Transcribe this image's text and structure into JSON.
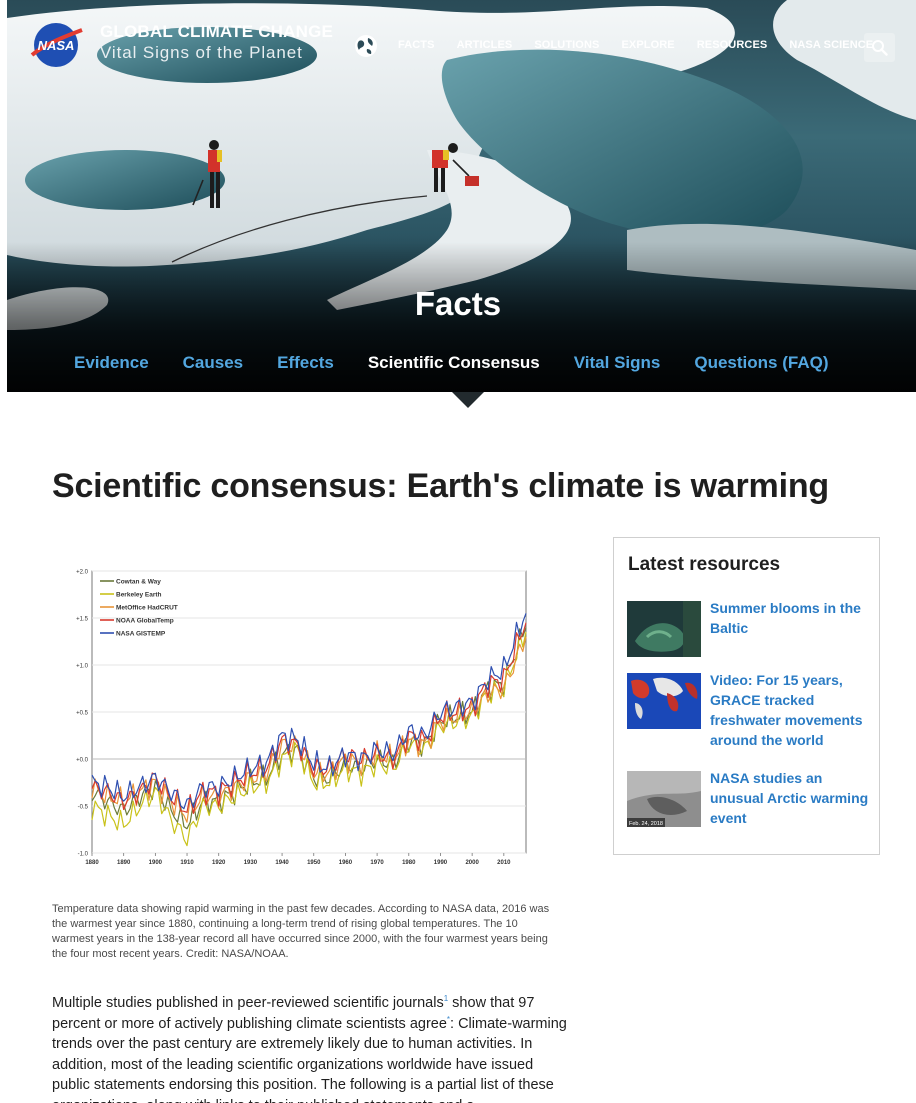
{
  "header": {
    "brand_title": "GLOBAL CLIMATE CHANGE",
    "brand_subtitle": "Vital Signs of the Planet",
    "logo_text": "NASA",
    "nav": [
      "FACTS",
      "ARTICLES",
      "SOLUTIONS",
      "EXPLORE",
      "RESOURCES",
      "NASA SCIENCE"
    ]
  },
  "hero": {
    "title": "Facts",
    "tabs": [
      {
        "label": "Evidence",
        "active": false
      },
      {
        "label": "Causes",
        "active": false
      },
      {
        "label": "Effects",
        "active": false
      },
      {
        "label": "Scientific Consensus",
        "active": true
      },
      {
        "label": "Vital Signs",
        "active": false
      },
      {
        "label": "Questions (FAQ)",
        "active": false
      }
    ]
  },
  "main": {
    "heading": "Scientific consensus: Earth's climate is warming",
    "caption": "Temperature data showing rapid warming in the past few decades. According to NASA data, 2016 was the warmest year since 1880, continuing a long-term trend of rising global temperatures. The 10 warmest years in the 138-year record all have occurred since 2000, with the four warmest years being the four most recent years. Credit: NASA/NOAA.",
    "body_part1": "Multiple studies published in peer-reviewed scientific journals",
    "body_ref": "1",
    "body_part2": " show that 97 percent or more of actively publishing climate scientists agree",
    "body_star": "*",
    "body_part3": ": Climate-warming trends over the past century are extremely likely due to human activities. In addition, most of the leading scientific organizations worldwide have issued public statements endorsing this position. The following is a partial list of these organizations, along with links to their published statements and a"
  },
  "sidebar": {
    "title": "Latest resources",
    "items": [
      {
        "label": "Summer blooms in the Baltic"
      },
      {
        "label": "Video: For 15 years, GRACE tracked freshwater movements around the world"
      },
      {
        "label": "NASA studies an unusual Arctic warming event",
        "thumb_text": "Feb. 24, 2018"
      }
    ]
  },
  "colors": {
    "link": "#2a7bc4",
    "tab_inactive": "#53a7e0",
    "tab_active": "#ffffff"
  },
  "chart_data": {
    "type": "line",
    "xlabel": "",
    "ylabel": "",
    "xlim": [
      1880,
      2017
    ],
    "ylim": [
      -1.0,
      2.0
    ],
    "x_ticks": [
      1880,
      1890,
      1900,
      1910,
      1920,
      1930,
      1940,
      1950,
      1960,
      1970,
      1980,
      1990,
      2000,
      2010
    ],
    "y_ticks": [
      "+2.0",
      "+1.5",
      "+1.0",
      "+0.5",
      "+0.0",
      "-0.5",
      "-1.0"
    ],
    "legend_position": "top-left",
    "x": [
      1880,
      1885,
      1890,
      1895,
      1900,
      1905,
      1910,
      1915,
      1920,
      1925,
      1930,
      1935,
      1940,
      1945,
      1950,
      1955,
      1960,
      1965,
      1970,
      1975,
      1980,
      1985,
      1990,
      1995,
      2000,
      2005,
      2010,
      2015,
      2017
    ],
    "series": [
      {
        "name": "Cowtan & Way",
        "color": "#6b7a3a",
        "values": [
          -0.35,
          -0.45,
          -0.55,
          -0.4,
          -0.3,
          -0.55,
          -0.7,
          -0.45,
          -0.45,
          -0.35,
          -0.25,
          -0.2,
          0.05,
          0.1,
          -0.2,
          -0.2,
          -0.05,
          -0.1,
          0.0,
          -0.05,
          0.2,
          0.15,
          0.4,
          0.45,
          0.5,
          0.75,
          0.8,
          1.25,
          1.4
        ]
      },
      {
        "name": "Berkeley Earth",
        "color": "#c9c21a",
        "values": [
          -0.5,
          -0.6,
          -0.7,
          -0.5,
          -0.35,
          -0.65,
          -0.85,
          -0.5,
          -0.5,
          -0.4,
          -0.3,
          -0.25,
          0.0,
          0.1,
          -0.25,
          -0.25,
          -0.1,
          -0.15,
          -0.05,
          -0.1,
          0.15,
          0.1,
          0.35,
          0.4,
          0.45,
          0.7,
          0.75,
          1.2,
          1.35
        ]
      },
      {
        "name": "MetOffice HadCRUT",
        "color": "#e8953a",
        "values": [
          -0.3,
          -0.4,
          -0.45,
          -0.35,
          -0.25,
          -0.45,
          -0.6,
          -0.4,
          -0.4,
          -0.3,
          -0.2,
          -0.15,
          0.15,
          0.15,
          -0.15,
          -0.15,
          0.0,
          -0.05,
          0.05,
          0.0,
          0.2,
          0.15,
          0.4,
          0.45,
          0.5,
          0.7,
          0.75,
          1.15,
          1.3
        ]
      },
      {
        "name": "NOAA GlobalTemp",
        "color": "#d93a2e",
        "values": [
          -0.3,
          -0.35,
          -0.45,
          -0.35,
          -0.2,
          -0.4,
          -0.55,
          -0.35,
          -0.35,
          -0.25,
          -0.15,
          -0.1,
          0.2,
          0.15,
          -0.1,
          -0.1,
          0.05,
          0.0,
          0.05,
          0.0,
          0.25,
          0.2,
          0.45,
          0.5,
          0.55,
          0.8,
          0.85,
          1.3,
          1.45
        ]
      },
      {
        "name": "NASA GISTEMP",
        "color": "#2e4fb0",
        "values": [
          -0.25,
          -0.3,
          -0.4,
          -0.3,
          -0.2,
          -0.35,
          -0.5,
          -0.3,
          -0.3,
          -0.2,
          -0.1,
          -0.05,
          0.25,
          0.2,
          -0.05,
          -0.1,
          0.05,
          0.0,
          0.1,
          0.05,
          0.3,
          0.25,
          0.5,
          0.55,
          0.6,
          0.85,
          0.95,
          1.4,
          1.55
        ]
      }
    ]
  }
}
